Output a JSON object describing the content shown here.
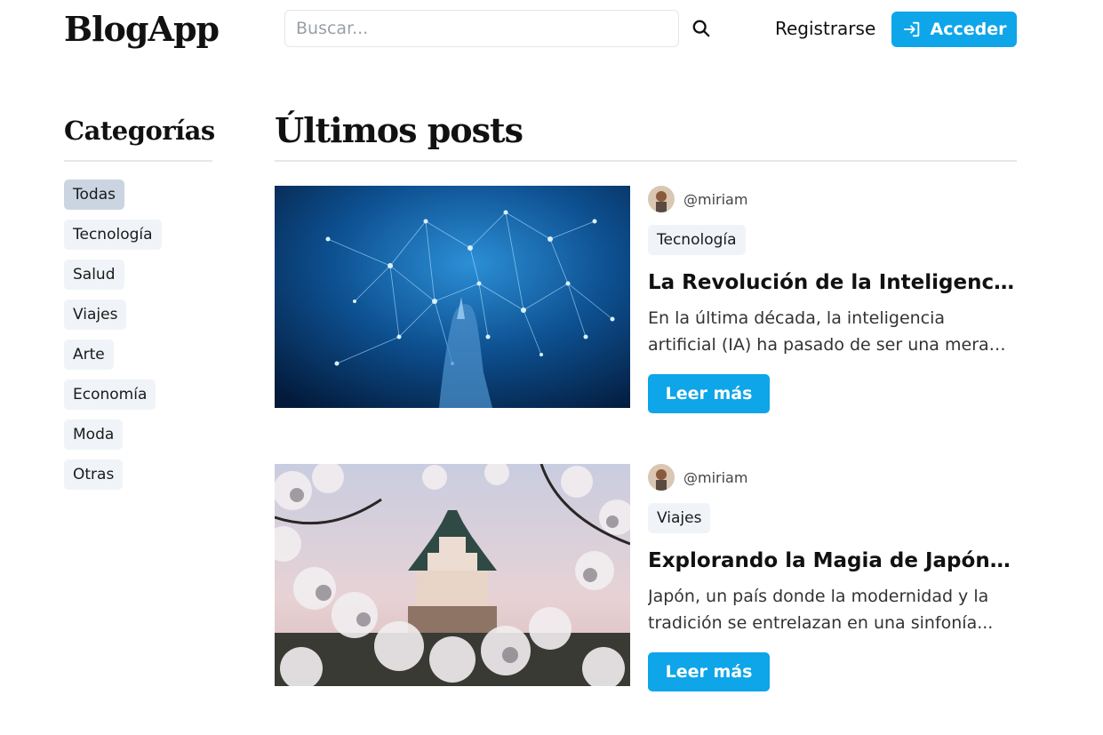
{
  "header": {
    "logo": "BlogApp",
    "search_placeholder": "Buscar...",
    "search_icon": "search-icon",
    "register_label": "Registrarse",
    "login_label": "Acceder",
    "login_icon": "login-arrow-icon",
    "accent_color": "#0ea5e9"
  },
  "sidebar": {
    "title": "Categorías",
    "categories": [
      {
        "label": "Todas",
        "active": true
      },
      {
        "label": "Tecnología",
        "active": false
      },
      {
        "label": "Salud",
        "active": false
      },
      {
        "label": "Viajes",
        "active": false
      },
      {
        "label": "Arte",
        "active": false
      },
      {
        "label": "Economía",
        "active": false
      },
      {
        "label": "Moda",
        "active": false
      },
      {
        "label": "Otras",
        "active": false
      }
    ]
  },
  "main": {
    "title": "Últimos posts",
    "posts": [
      {
        "author": "@miriam",
        "category": "Tecnología",
        "title": "La Revolución de la Inteligencia Artificial",
        "excerpt": "En la última década, la inteligencia artificial (IA) ha pasado de ser una mera promesa",
        "read_more": "Leer más",
        "image": "ai-network-image"
      },
      {
        "author": "@miriam",
        "category": "Viajes",
        "title": "Explorando la Magia de Japón: ...",
        "excerpt": "Japón, un país donde la modernidad y la tradición se entrelazan en una sinfonía...",
        "read_more": "Leer más",
        "image": "japan-castle-image"
      }
    ]
  }
}
